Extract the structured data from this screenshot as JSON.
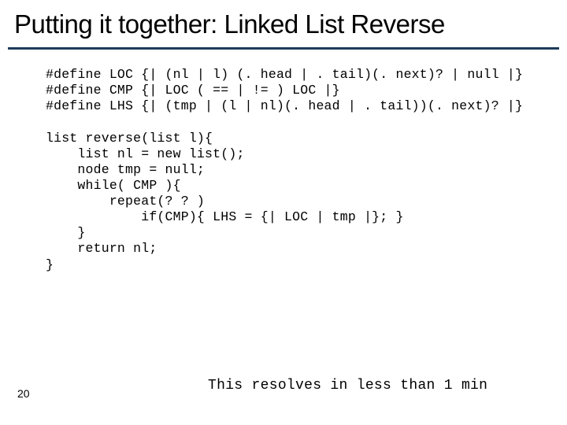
{
  "title": "Putting it together: Linked List Reverse",
  "code": "#define LOC {| (nl | l) (. head | . tail)(. next)? | null |}\n#define CMP {| LOC ( == | != ) LOC |}\n#define LHS {| (tmp | (l | nl)(. head | . tail))(. next)? |}\n\nlist reverse(list l){\n    list nl = new list();\n    node tmp = null;\n    while( CMP ){\n        repeat(? ? )\n            if(CMP){ LHS = {| LOC | tmp |}; }\n    }\n    return nl;\n}",
  "footer": "This resolves in less than 1 min",
  "page": "20"
}
